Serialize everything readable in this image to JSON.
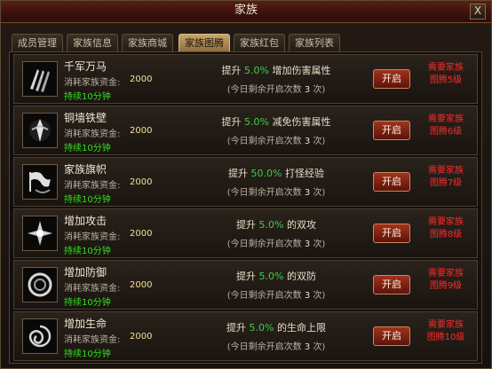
{
  "window": {
    "title": "家族",
    "close_label": "X"
  },
  "tabs": [
    {
      "label": "成员管理"
    },
    {
      "label": "家族信息"
    },
    {
      "label": "家族商城"
    },
    {
      "label": "家族图腾"
    },
    {
      "label": "家族红包"
    },
    {
      "label": "家族列表"
    }
  ],
  "active_tab": "家族图腾",
  "common": {
    "cost_label": "消耗家族资金:",
    "effect_prefix": "提升",
    "remaining_prefix": "(今日剩余开启次数",
    "remaining_suffix": "次)",
    "open_button": "开启",
    "req_prefix": "需要家族",
    "req_line2_prefix": "图腾"
  },
  "totems": [
    {
      "name": "千军万马",
      "cost": "2000",
      "duration": "持续10分钟",
      "percent": "5.0%",
      "effect": "增加伤害属性",
      "remaining": "3",
      "req_level": "5级",
      "icon": "claw-strike-icon"
    },
    {
      "name": "铜墙铁壁",
      "cost": "2000",
      "duration": "持续10分钟",
      "percent": "5.0%",
      "effect": "减免伤害属性",
      "remaining": "3",
      "req_level": "6级",
      "icon": "iron-wall-icon"
    },
    {
      "name": "家族旗帜",
      "cost": "2000",
      "duration": "持续10分钟",
      "percent": "50.0%",
      "effect": "打怪经验",
      "remaining": "3",
      "req_level": "7级",
      "icon": "flag-icon"
    },
    {
      "name": "增加攻击",
      "cost": "2000",
      "duration": "持续10分钟",
      "percent": "5.0%",
      "effect": "的双攻",
      "remaining": "3",
      "req_level": "8级",
      "icon": "attack-burst-icon"
    },
    {
      "name": "增加防御",
      "cost": "2000",
      "duration": "持续10分钟",
      "percent": "5.0%",
      "effect": "的双防",
      "remaining": "3",
      "req_level": "9级",
      "icon": "defense-ring-icon"
    },
    {
      "name": "增加生命",
      "cost": "2000",
      "duration": "持续10分钟",
      "percent": "5.0%",
      "effect": "的生命上限",
      "remaining": "3",
      "req_level": "10级",
      "icon": "life-swirl-icon"
    }
  ],
  "colors": {
    "accent_green": "#39d04a",
    "duration_green": "#2ee31b",
    "requirement_red": "#ff2a2a",
    "cost_yellow": "#f0e09b"
  }
}
